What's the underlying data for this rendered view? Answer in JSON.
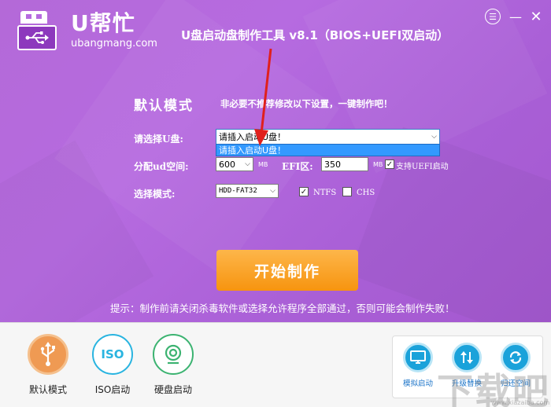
{
  "brand": {
    "name": "U帮忙",
    "url": "ubangmang.com"
  },
  "window": {
    "title": "U盘启动盘制作工具 v8.1（BIOS+UEFI双启动）",
    "menu_glyph": "☰",
    "min_glyph": "—",
    "close_glyph": "✕"
  },
  "section": {
    "title": "默认模式",
    "subtitle": "非必要不推荐修改以下设置，一键制作吧！"
  },
  "form": {
    "disk_label": "请选择U盘:",
    "disk_value": "请插入启动U盘！",
    "disk_dropdown_option": "请插入启动U盘！",
    "partition_label": "分配ud空间:",
    "partition_value": "600",
    "unit_mb": "MB",
    "efi_label": "EFI区:",
    "efi_value": "350",
    "uefi_label": "支持UEFI启动",
    "uefi_checked": true,
    "mode_label": "选择模式:",
    "mode_value": "HDD-FAT32",
    "ntfs_label": "NTFS",
    "ntfs_checked": true,
    "chs_label": "CHS",
    "chs_checked": false
  },
  "start_button": "开始制作",
  "tip": "提示：制作前请关闭杀毒软件或选择允许程序全部通过，否则可能会制作失败！",
  "modes": [
    {
      "label": "默认模式",
      "icon": "usb-icon",
      "color": "#ef9a53"
    },
    {
      "label": "ISO启动",
      "icon": "iso-icon",
      "color": "#29b4e0"
    },
    {
      "label": "硬盘启动",
      "icon": "hard-disk-icon",
      "color": "#3cb371"
    }
  ],
  "iso_icon_text": "ISO",
  "tools": [
    {
      "label": "模拟启动",
      "icon": "monitor-icon"
    },
    {
      "label": "升级替换",
      "icon": "upgrade-icon"
    },
    {
      "label": "归还空间",
      "icon": "refresh-icon"
    }
  ],
  "watermark": {
    "text": "下载吧",
    "url": "www.xiazaiba.com"
  },
  "colors": {
    "accent_purple": "#b66be0",
    "start_orange": "#f7940f",
    "tool_blue": "#1aa2da"
  }
}
